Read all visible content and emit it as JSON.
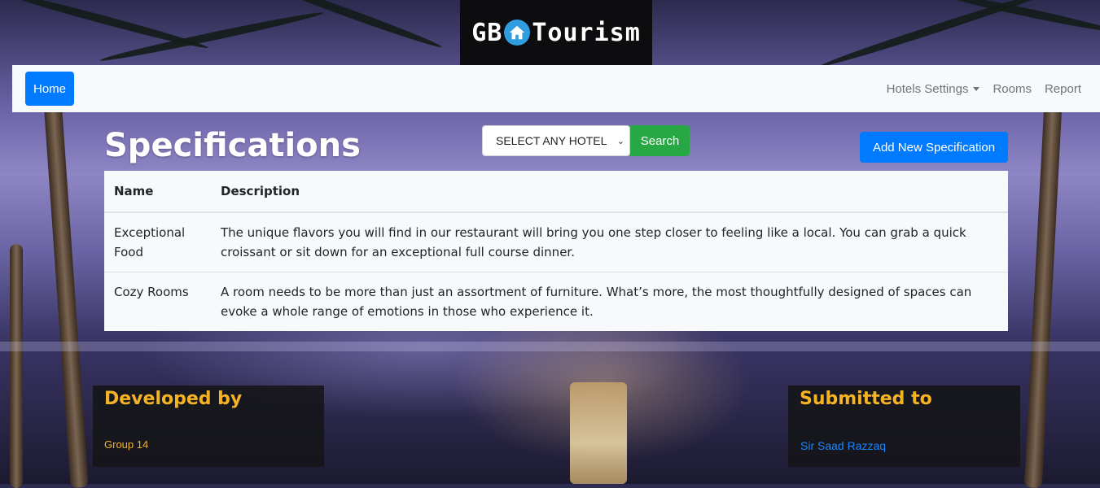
{
  "brand": {
    "text_left": "GB",
    "text_right": "Tourism",
    "icon": "house-icon"
  },
  "nav": {
    "home": "Home",
    "items": [
      "Hotels Settings",
      "Rooms",
      "Report"
    ]
  },
  "page": {
    "title": "Specifications",
    "hotel_select": "SELECT ANY HOTEL",
    "search": "Search",
    "add_button": "Add New Specification"
  },
  "table": {
    "headers": [
      "Name",
      "Description"
    ],
    "rows": [
      {
        "name": "Exceptional Food",
        "description": "The unique flavors you will find in our restaurant will bring you one step closer to feeling like a local. You can grab a quick croissant or sit down for an exceptional full course dinner."
      },
      {
        "name": "Cozy Rooms",
        "description": "A room needs to be more than just an assortment of furniture. What’s more, the most thoughtfully designed of spaces can evoke a whole range of emotions in those who experience it."
      }
    ]
  },
  "footer": {
    "developed_title": "Developed by",
    "developed_by": "Group 14",
    "submitted_title": "Submitted to",
    "submitted_to": "Sir Saad Razzaq"
  },
  "colors": {
    "primary": "#007bff",
    "success": "#28a745",
    "accent": "#f5b324"
  }
}
